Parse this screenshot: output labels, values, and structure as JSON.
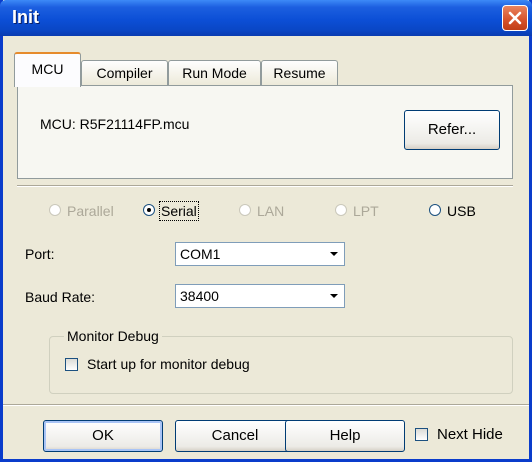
{
  "window": {
    "title": "Init"
  },
  "tabs": [
    {
      "label": "MCU",
      "active": true
    },
    {
      "label": "Compiler",
      "active": false
    },
    {
      "label": "Run Mode",
      "active": false
    },
    {
      "label": "Resume",
      "active": false
    }
  ],
  "mcu": {
    "label": "MCU:  R5F21114FP.mcu",
    "refer_label": "Refer..."
  },
  "connection": {
    "options": [
      {
        "label": "Parallel",
        "enabled": false,
        "selected": false
      },
      {
        "label": "Serial",
        "enabled": true,
        "selected": true
      },
      {
        "label": "LAN",
        "enabled": false,
        "selected": false
      },
      {
        "label": "LPT",
        "enabled": false,
        "selected": false
      },
      {
        "label": "USB",
        "enabled": true,
        "selected": false
      }
    ]
  },
  "port": {
    "label": "Port:",
    "value": "COM1"
  },
  "baud": {
    "label": "Baud Rate:",
    "value": "38400"
  },
  "monitor": {
    "title": "Monitor Debug",
    "checkbox_label": "Start up for monitor debug",
    "checked": false
  },
  "buttons": {
    "ok": "OK",
    "cancel": "Cancel",
    "help": "Help",
    "next_hide": "Next Hide"
  },
  "colors": {
    "titlebar": "#0a46c4",
    "close": "#d6512a",
    "face": "#ece9d8"
  }
}
